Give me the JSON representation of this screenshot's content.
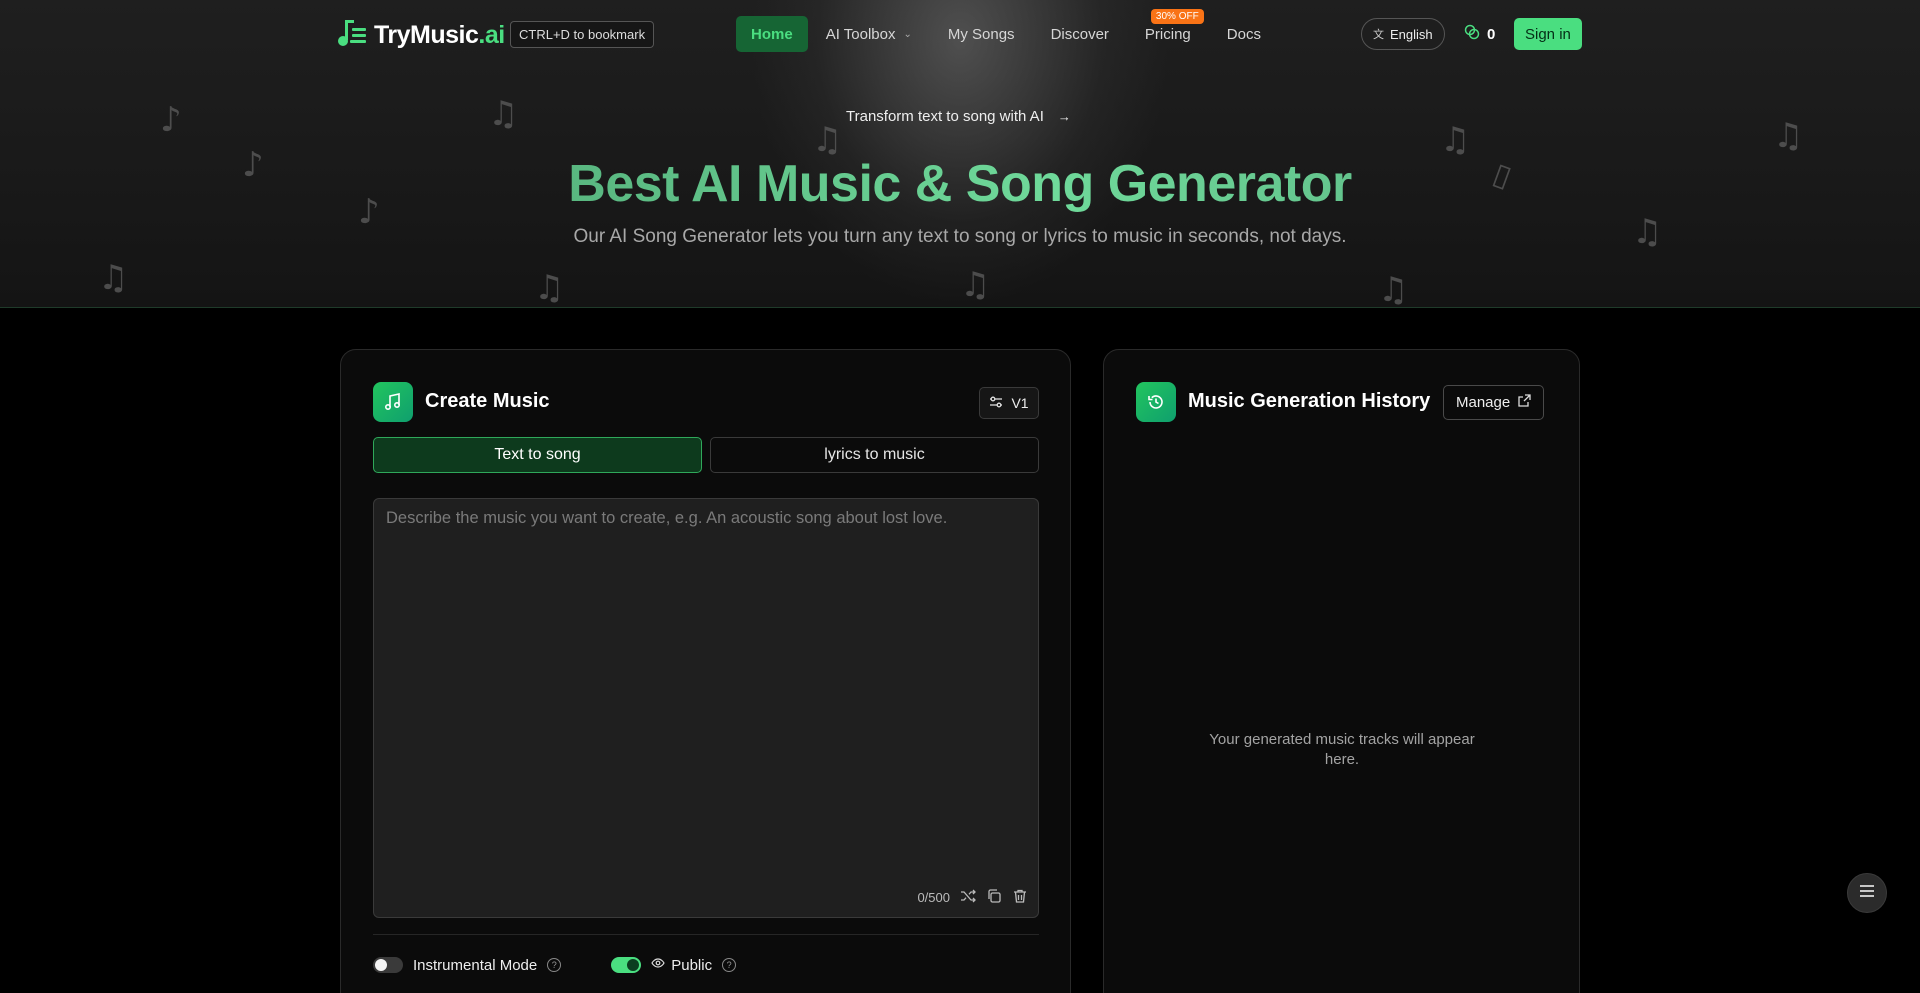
{
  "nav": {
    "brand_prefix": "TryMusic",
    "brand_suffix": ".ai",
    "bookmark_hint": "CTRL+D to bookmark",
    "links": [
      {
        "label": "Home",
        "active": true
      },
      {
        "label": "AI Toolbox",
        "dropdown": true
      },
      {
        "label": "My Songs"
      },
      {
        "label": "Discover"
      },
      {
        "label": "Pricing",
        "badge": "30% OFF"
      },
      {
        "label": "Docs"
      }
    ],
    "language": "English",
    "credits": "0",
    "signin": "Sign in"
  },
  "hero": {
    "tagline": "Transform text to song with AI",
    "title": "Best AI Music & Song Generator",
    "subtitle": "Our AI Song Generator lets you turn any text to song or lyrics to music in seconds, not days."
  },
  "create": {
    "title": "Create Music",
    "version": "V1",
    "tabs": [
      {
        "label": "Text to song",
        "active": true
      },
      {
        "label": "lyrics to music",
        "active": false
      }
    ],
    "prompt_placeholder": "Describe the music you want to create, e.g. An acoustic song about lost love.",
    "prompt_value": "",
    "char_count": "0/500",
    "instrumental_label": "Instrumental Mode",
    "instrumental_on": false,
    "public_label": "Public",
    "public_on": true
  },
  "history": {
    "title": "Music Generation History",
    "manage": "Manage",
    "empty_message": "Your generated music tracks will appear here."
  },
  "colors": {
    "accent": "#4ade80",
    "accent_dark": "#166534",
    "badge": "#f97316",
    "background": "#000000"
  }
}
